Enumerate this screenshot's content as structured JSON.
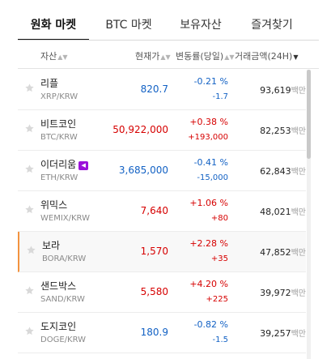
{
  "tabs": [
    {
      "label": "원화 마켓",
      "active": true
    },
    {
      "label": "BTC 마켓",
      "active": false
    },
    {
      "label": "보유자산",
      "active": false
    },
    {
      "label": "즐겨찾기",
      "active": false
    }
  ],
  "header": {
    "asset": "자산",
    "price": "현재가",
    "change": "변동률(당일)",
    "volume": "거래금액(24H)",
    "sort_icon": "▲▼",
    "sort_desc_icon": "▼"
  },
  "colors": {
    "up": "#d60000",
    "down": "#1261c4",
    "highlight_bar": "#f3933f"
  },
  "rows": [
    {
      "name": "리플",
      "pair": "XRP/KRW",
      "price": "820.7",
      "rate": "-0.21 %",
      "diff": "-1.7",
      "volume": "93,619",
      "unit": "백만",
      "dir": "down"
    },
    {
      "name": "비트코인",
      "pair": "BTC/KRW",
      "price": "50,922,000",
      "rate": "+0.38 %",
      "diff": "+193,000",
      "volume": "82,253",
      "unit": "백만",
      "dir": "up"
    },
    {
      "name": "이더리움",
      "pair": "ETH/KRW",
      "price": "3,685,000",
      "rate": "-0.41 %",
      "diff": "-15,000",
      "volume": "62,843",
      "unit": "백만",
      "dir": "down",
      "badge": "speaker-icon"
    },
    {
      "name": "위믹스",
      "pair": "WEMIX/KRW",
      "price": "7,640",
      "rate": "+1.06 %",
      "diff": "+80",
      "volume": "48,021",
      "unit": "백만",
      "dir": "up"
    },
    {
      "name": "보라",
      "pair": "BORA/KRW",
      "price": "1,570",
      "rate": "+2.28 %",
      "diff": "+35",
      "volume": "47,852",
      "unit": "백만",
      "dir": "up",
      "highlight": true
    },
    {
      "name": "샌드박스",
      "pair": "SAND/KRW",
      "price": "5,580",
      "rate": "+4.20 %",
      "diff": "+225",
      "volume": "39,972",
      "unit": "백만",
      "dir": "up"
    },
    {
      "name": "도지코인",
      "pair": "DOGE/KRW",
      "price": "180.9",
      "rate": "-0.82 %",
      "diff": "-1.5",
      "volume": "39,257",
      "unit": "백만",
      "dir": "down"
    }
  ]
}
